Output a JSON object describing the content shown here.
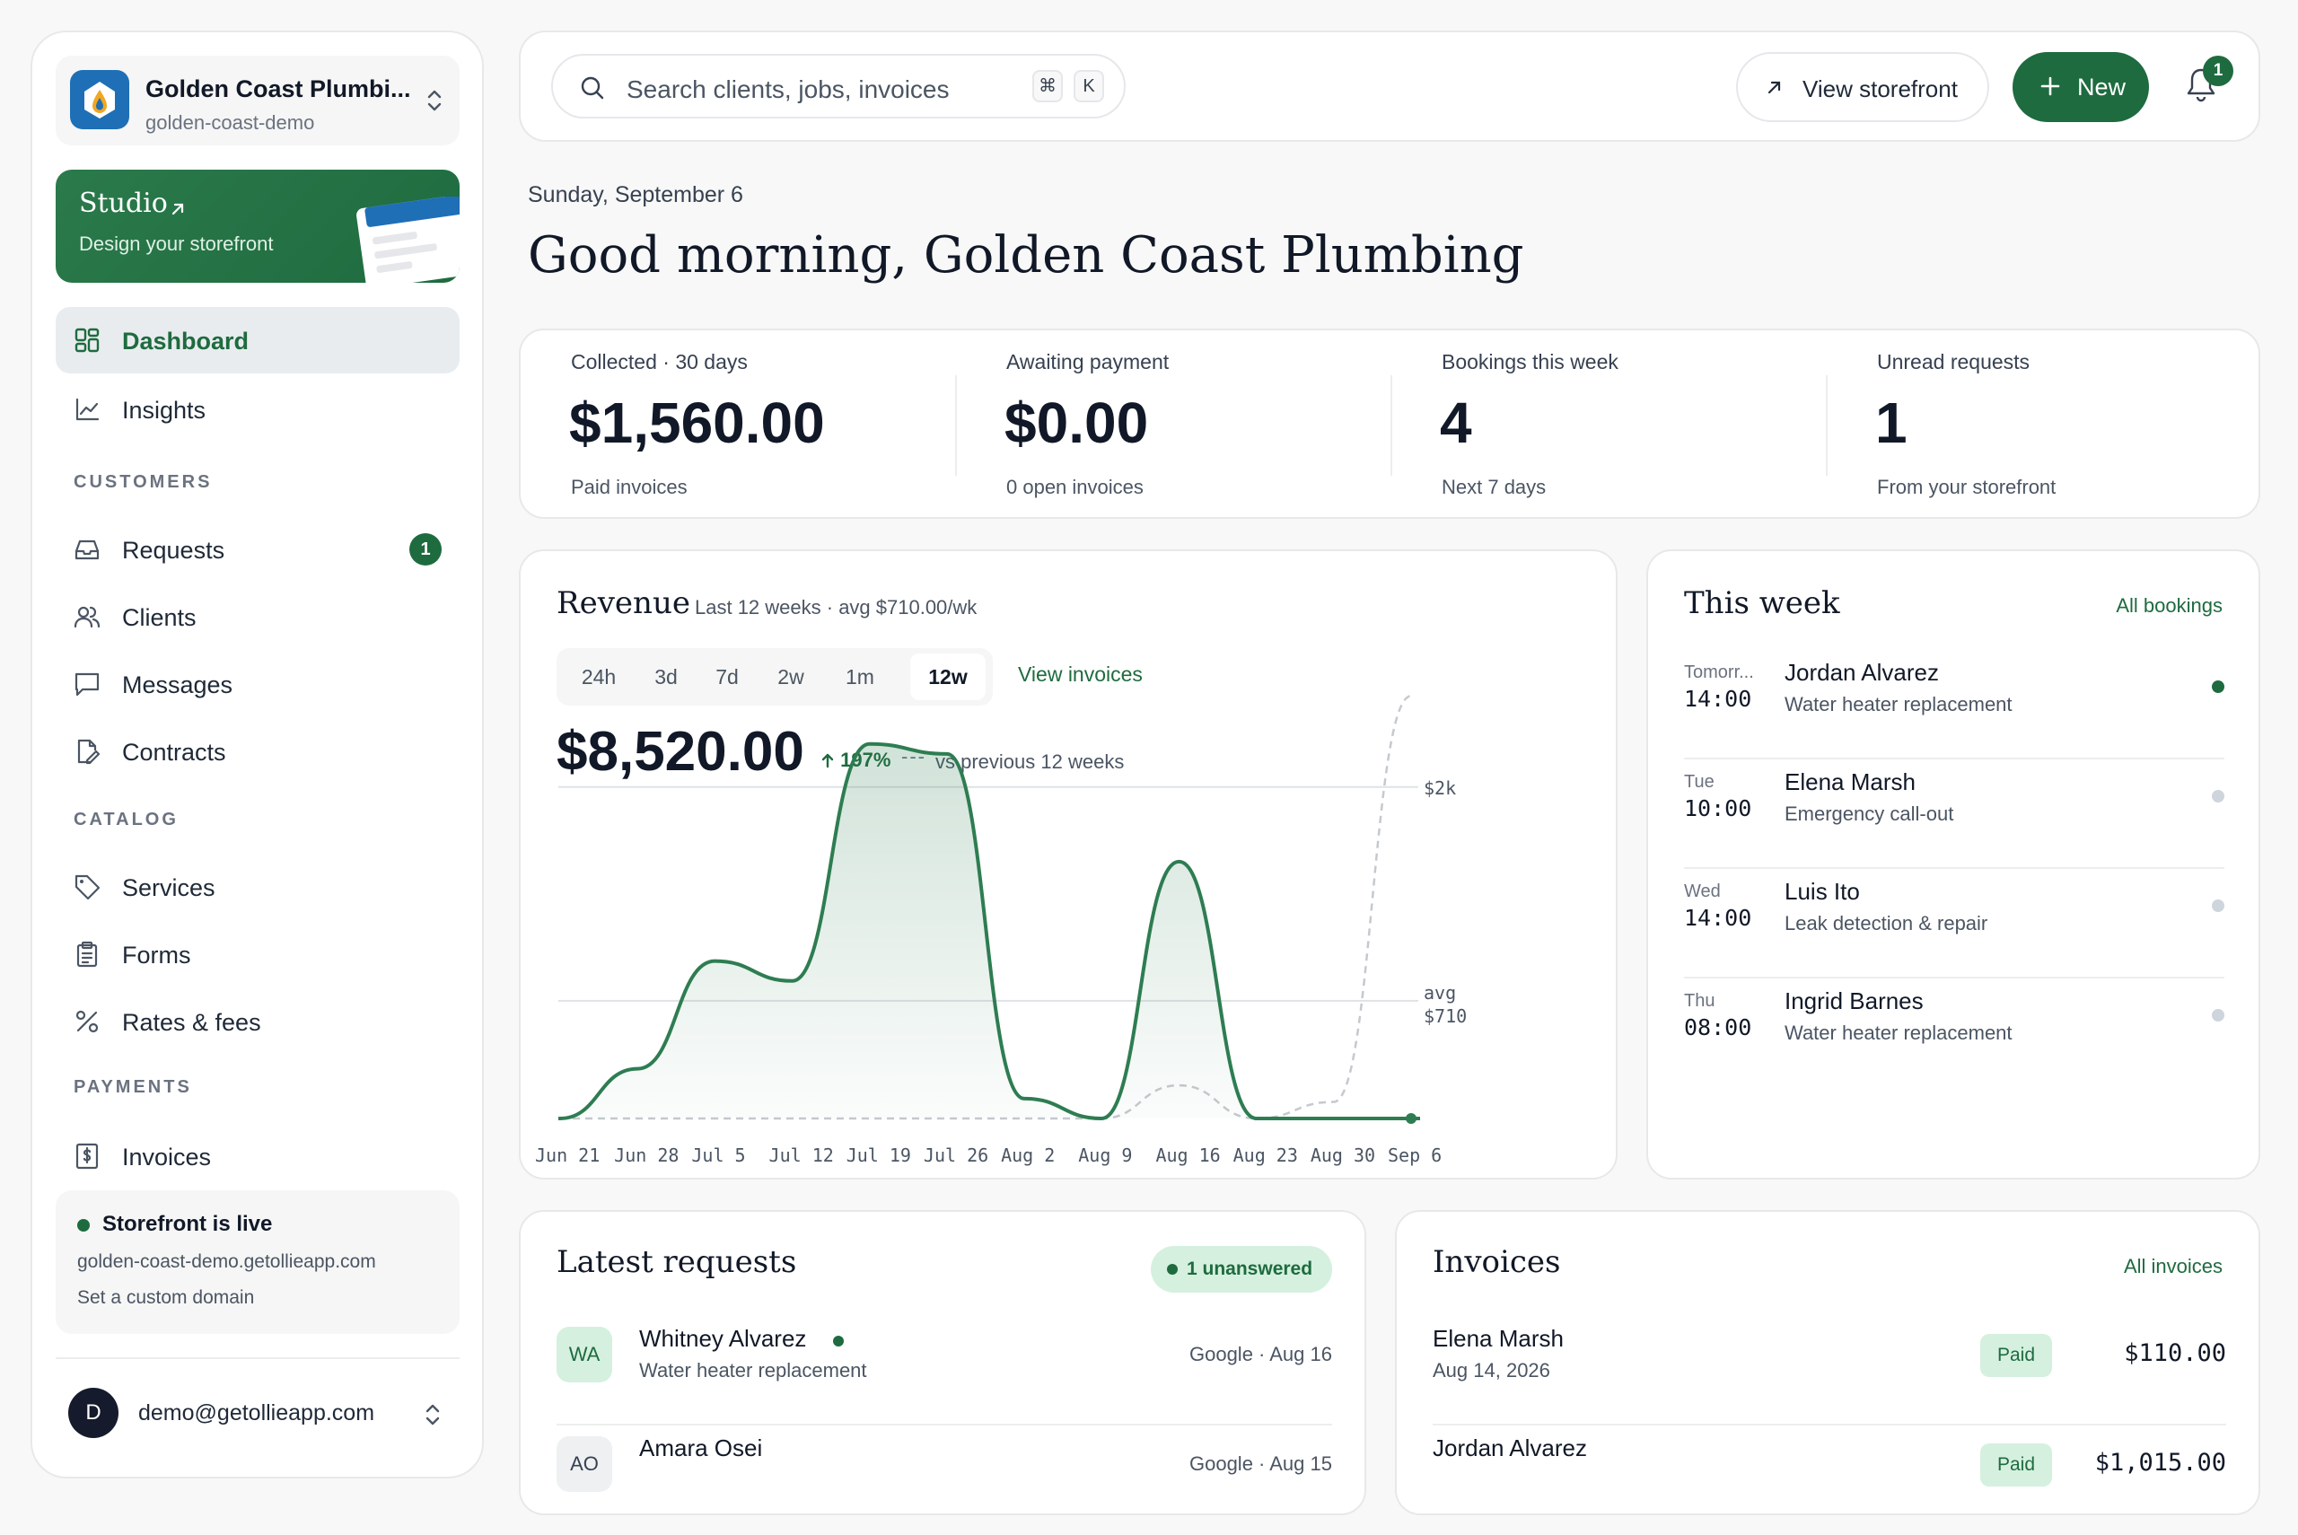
{
  "workspace": {
    "name": "Golden Coast Plumbi...",
    "slug": "golden-coast-demo"
  },
  "studio": {
    "title": "Studio",
    "subtitle": "Design your storefront"
  },
  "nav": {
    "dashboard": "Dashboard",
    "insights": "Insights",
    "sections": {
      "customers": "CUSTOMERS",
      "catalog": "CATALOG",
      "payments": "PAYMENTS"
    },
    "requests": {
      "label": "Requests",
      "badge": "1"
    },
    "clients": "Clients",
    "messages": "Messages",
    "contracts": "Contracts",
    "services": "Services",
    "forms": "Forms",
    "rates": "Rates & fees",
    "invoices": "Invoices"
  },
  "storefront_status": {
    "title": "Storefront is live",
    "url": "golden-coast-demo.getollieapp.com",
    "custom_domain": "Set a custom domain"
  },
  "account": {
    "initial": "D",
    "email": "demo@getollieapp.com"
  },
  "topbar": {
    "search_placeholder": "Search clients, jobs, invoices",
    "kbd1": "⌘",
    "kbd2": "K",
    "view_storefront": "View storefront",
    "new_label": "New",
    "notification_count": "1"
  },
  "header": {
    "date": "Sunday, September 6",
    "greeting": "Good morning, Golden Coast Plumbing"
  },
  "stats": [
    {
      "label": "Collected · 30 days",
      "value": "$1,560.00",
      "sub": "Paid invoices"
    },
    {
      "label": "Awaiting payment",
      "value": "$0.00",
      "sub": "0 open invoices"
    },
    {
      "label": "Bookings this week",
      "value": "4",
      "sub": "Next 7 days"
    },
    {
      "label": "Unread requests",
      "value": "1",
      "sub": "From your storefront"
    }
  ],
  "revenue": {
    "title": "Revenue",
    "subtitle": "Last 12 weeks · avg $710.00/wk",
    "ranges": [
      "24h",
      "3d",
      "7d",
      "2w",
      "1m",
      "12w"
    ],
    "active_range": "12w",
    "view_invoices": "View invoices",
    "total": "$8,520.00",
    "change": "197%",
    "change_dash": "---",
    "comparison": "vs previous 12 weeks"
  },
  "chart_data": {
    "type": "area",
    "x": [
      "Jun 21",
      "Jun 28",
      "Jul 5",
      "Jul 12",
      "Jul 19",
      "Jul 26",
      "Aug 2",
      "Aug 9",
      "Aug 16",
      "Aug 23",
      "Aug 30",
      "Sep 6"
    ],
    "series": [
      {
        "values": [
          0,
          300,
          950,
          830,
          2260,
          2200,
          120,
          0,
          1550,
          0,
          0,
          0
        ]
      },
      {
        "values": [
          0,
          0,
          0,
          0,
          0,
          0,
          0,
          0,
          200,
          0,
          100,
          2550
        ]
      }
    ],
    "reference_lines": [
      {
        "label": "$2k",
        "value": 2000
      },
      {
        "label": "avg",
        "sublabel": "$710",
        "value": 710
      }
    ],
    "ylim": [
      0,
      2600
    ],
    "grid": true,
    "colors": {
      "current": "#2e7d52",
      "previous": "#c5c9cf"
    }
  },
  "week": {
    "title": "This week",
    "all_link": "All bookings",
    "items": [
      {
        "day": "Tomorr...",
        "time": "14:00",
        "name": "Jordan Alvarez",
        "service": "Water heater replacement",
        "highlight": true
      },
      {
        "day": "Tue",
        "time": "10:00",
        "name": "Elena Marsh",
        "service": "Emergency call-out",
        "highlight": false
      },
      {
        "day": "Wed",
        "time": "14:00",
        "name": "Luis Ito",
        "service": "Leak detection & repair",
        "highlight": false
      },
      {
        "day": "Thu",
        "time": "08:00",
        "name": "Ingrid Barnes",
        "service": "Water heater replacement",
        "highlight": false
      }
    ]
  },
  "requests": {
    "title": "Latest requests",
    "pill": "1 unanswered",
    "items": [
      {
        "initials": "WA",
        "name": "Whitney Alvarez",
        "service": "Water heater replacement",
        "meta": "Google · Aug 16",
        "unread": true
      },
      {
        "initials": "AO",
        "name": "Amara Osei",
        "service": "",
        "meta": "Google · Aug 15",
        "unread": false
      }
    ]
  },
  "invoices_card": {
    "title": "Invoices",
    "all_link": "All invoices",
    "items": [
      {
        "name": "Elena Marsh",
        "date": "Aug 14, 2026",
        "status": "Paid",
        "amount": "$110.00"
      },
      {
        "name": "Jordan Alvarez",
        "date": "",
        "status": "Paid",
        "amount": "$1,015.00"
      }
    ]
  },
  "colors": {
    "brand": "#1e6b3f",
    "accent_bg": "#d5f0df",
    "logo_blue": "#1f6fb7"
  }
}
